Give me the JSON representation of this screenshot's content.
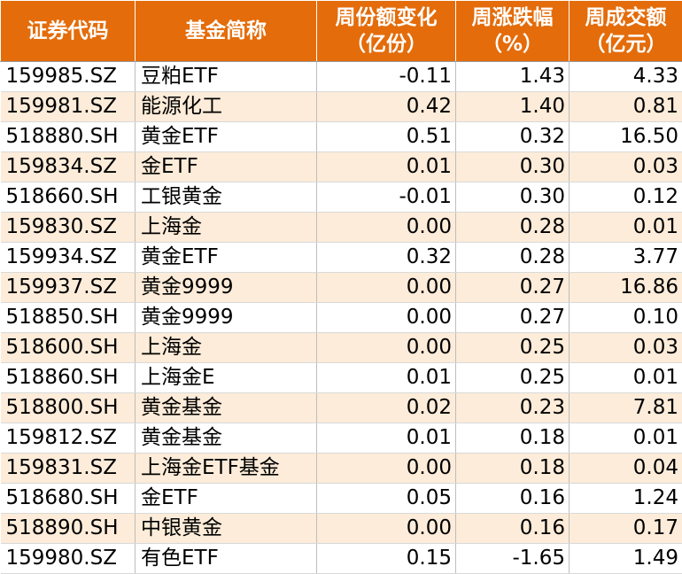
{
  "header": {
    "code": "证券代码",
    "name": "基金简称",
    "share_change_line1": "周份额变化",
    "share_change_line2": "（亿份）",
    "weekly_change_line1": "周涨跌幅",
    "weekly_change_line2": "（%）",
    "turnover_line1": "周成交额",
    "turnover_line2": "（亿元）"
  },
  "rows": [
    {
      "code": "159985.SZ",
      "name": "豆粕ETF",
      "share": "-0.11",
      "pct": "1.43",
      "turnover": "4.33"
    },
    {
      "code": "159981.SZ",
      "name": "能源化工",
      "share": "0.42",
      "pct": "1.40",
      "turnover": "0.81"
    },
    {
      "code": "518880.SH",
      "name": "黄金ETF",
      "share": "0.51",
      "pct": "0.32",
      "turnover": "16.50"
    },
    {
      "code": "159834.SZ",
      "name": "金ETF",
      "share": "0.01",
      "pct": "0.30",
      "turnover": "0.03"
    },
    {
      "code": "518660.SH",
      "name": "工银黄金",
      "share": "-0.01",
      "pct": "0.30",
      "turnover": "0.12"
    },
    {
      "code": "159830.SZ",
      "name": "上海金",
      "share": "0.00",
      "pct": "0.28",
      "turnover": "0.01"
    },
    {
      "code": "159934.SZ",
      "name": "黄金ETF",
      "share": "0.32",
      "pct": "0.28",
      "turnover": "3.77"
    },
    {
      "code": "159937.SZ",
      "name": "黄金9999",
      "share": "0.00",
      "pct": "0.27",
      "turnover": "16.86"
    },
    {
      "code": "518850.SH",
      "name": "黄金9999",
      "share": "0.00",
      "pct": "0.27",
      "turnover": "0.10"
    },
    {
      "code": "518600.SH",
      "name": "上海金",
      "share": "0.00",
      "pct": "0.25",
      "turnover": "0.03"
    },
    {
      "code": "518860.SH",
      "name": "上海金E",
      "share": "0.01",
      "pct": "0.25",
      "turnover": "0.01"
    },
    {
      "code": "518800.SH",
      "name": "黄金基金",
      "share": "0.02",
      "pct": "0.23",
      "turnover": "7.81"
    },
    {
      "code": "159812.SZ",
      "name": "黄金基金",
      "share": "0.01",
      "pct": "0.18",
      "turnover": "0.01"
    },
    {
      "code": "159831.SZ",
      "name": "上海金ETF基金",
      "share": "0.00",
      "pct": "0.18",
      "turnover": "0.04"
    },
    {
      "code": "518680.SH",
      "name": "金ETF",
      "share": "0.05",
      "pct": "0.16",
      "turnover": "1.24"
    },
    {
      "code": "518890.SH",
      "name": "中银黄金",
      "share": "0.00",
      "pct": "0.16",
      "turnover": "0.17"
    },
    {
      "code": "159980.SZ",
      "name": "有色ETF",
      "share": "0.15",
      "pct": "-1.65",
      "turnover": "1.49"
    }
  ],
  "colors": {
    "header_bg": "#e46c0a",
    "header_text": "#ffffff",
    "stripe_bg": "#fcecd9",
    "row_bg": "#ffffff"
  }
}
